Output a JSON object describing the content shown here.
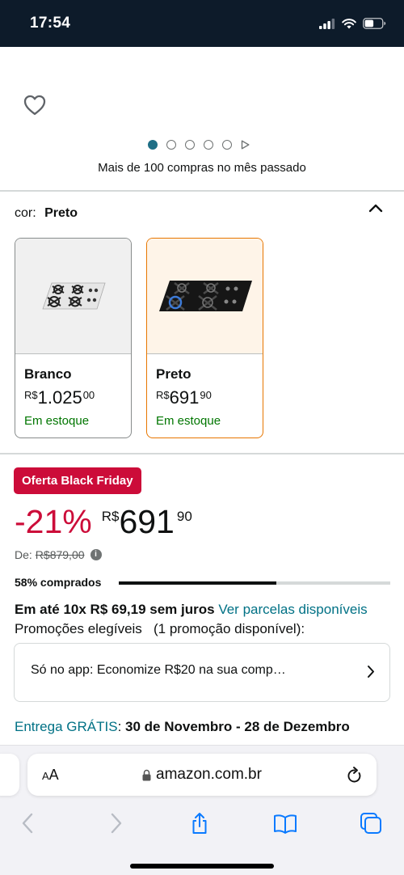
{
  "status": {
    "time": "17:54"
  },
  "gallery": {
    "dot_count": 5,
    "active_dot": 0,
    "bought_text": "Mais de 100 compras no mês passado"
  },
  "color_selector": {
    "label": "cor:",
    "selected": "Preto",
    "options": [
      {
        "name": "Branco",
        "currency": "R$",
        "price_int": "1.025",
        "price_cents": "00",
        "stock": "Em estoque"
      },
      {
        "name": "Preto",
        "currency": "R$",
        "price_int": "691",
        "price_cents": "90",
        "stock": "Em estoque"
      }
    ]
  },
  "offer": {
    "badge": "Oferta Black Friday",
    "discount": "-21%",
    "currency": "R$",
    "price_int": "691",
    "price_cents": "90",
    "was_label": "De:",
    "was_price": "R$879,00",
    "sold_label": "58% comprados",
    "sold_percent": 58
  },
  "installments": {
    "text": "Em até 10x R$ 69,19 sem juros",
    "link": "Ver parcelas disponíveis"
  },
  "promotions": {
    "label": "Promoções elegíveis",
    "count": "(1 promoção disponível):",
    "promo_text": "Só no app: Economize R$20 na sua comp…"
  },
  "delivery": {
    "link": "Entrega GRÁTIS",
    "colon": ":",
    "dates": "30 de Novembro - 28 de Dezembro"
  },
  "browser": {
    "aa_small": "A",
    "aa_large": "A",
    "url": "amazon.com.br"
  },
  "colors": {
    "accent_red": "#cc0c39",
    "link_teal": "#007185",
    "stock_green": "#007600",
    "selected_orange": "#e77600",
    "ios_blue": "#0a7aff"
  }
}
